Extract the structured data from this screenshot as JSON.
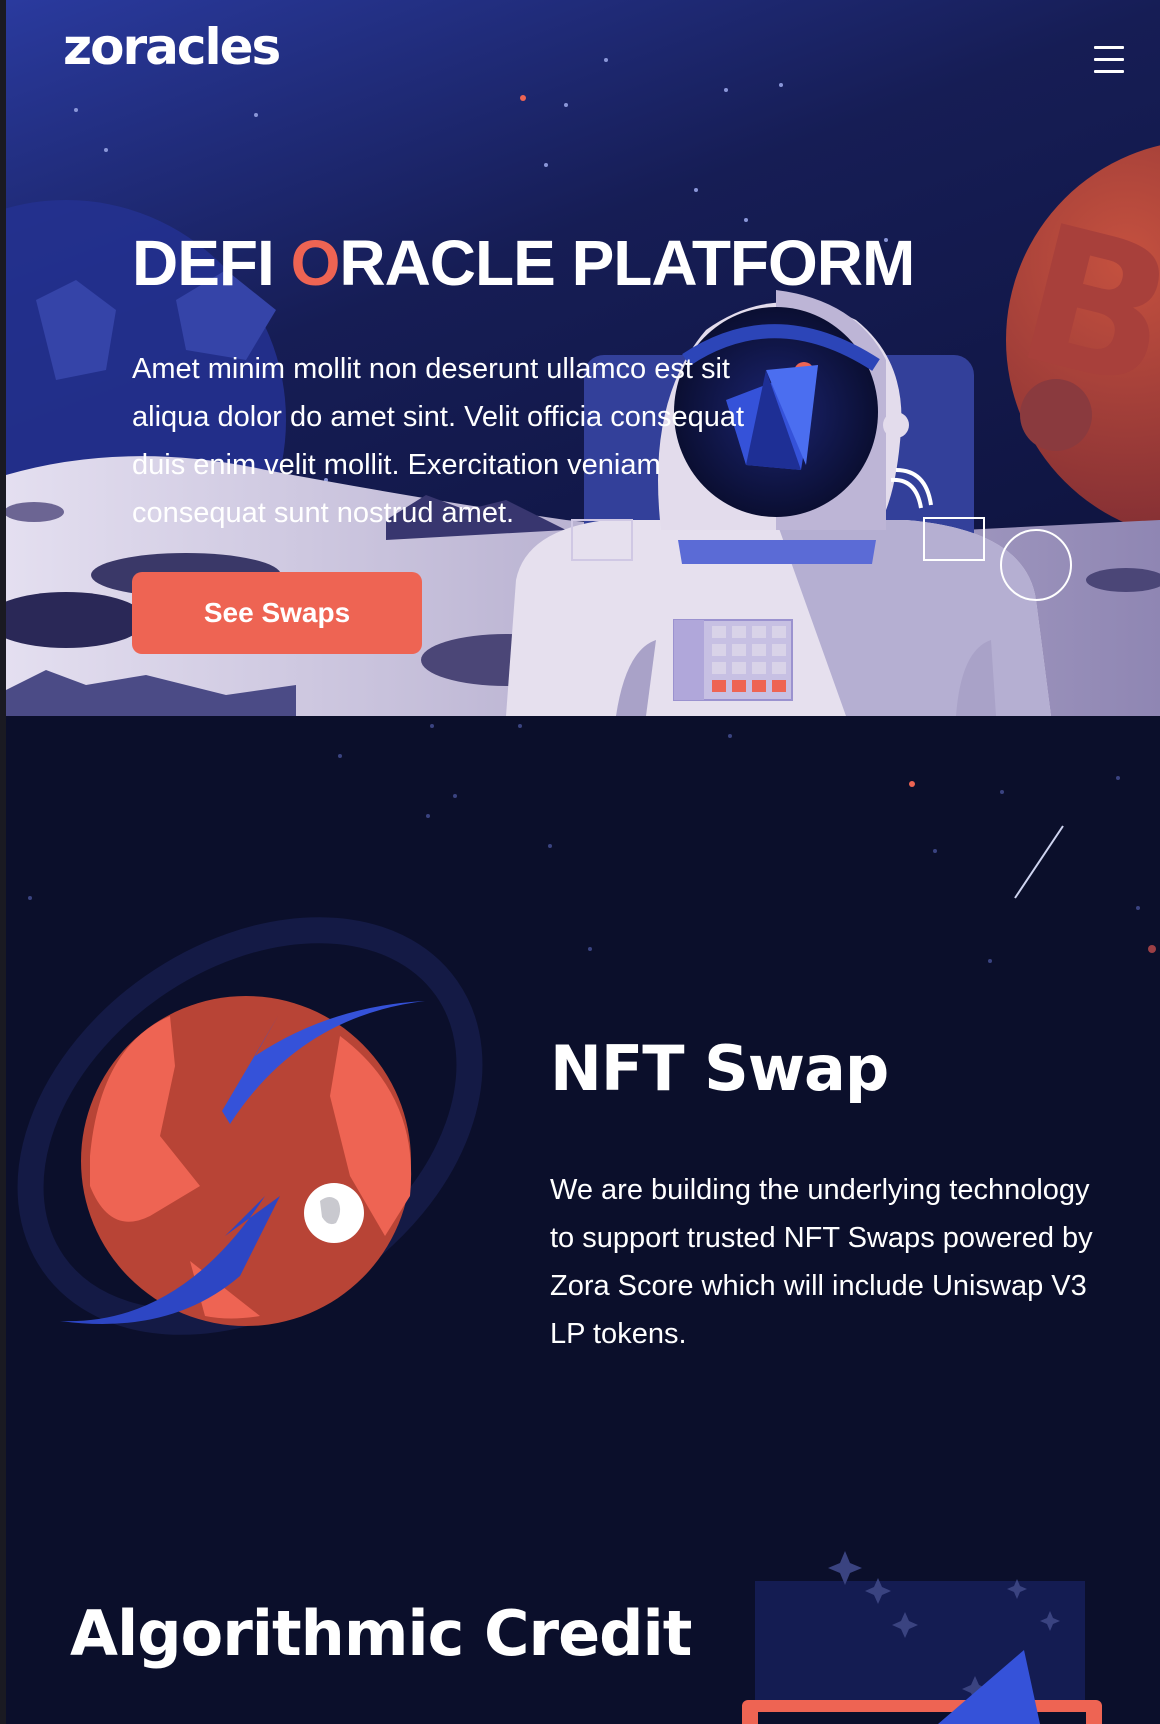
{
  "header": {
    "logo": "zoracles",
    "menu_icon": "hamburger-menu-icon"
  },
  "hero": {
    "title_prefix": "DEFI ",
    "title_accent": "O",
    "title_rest": "RACLE PLATFORM",
    "description": "Amet minim mollit non deserunt ullamco est sit aliqua dolor do amet sint. Velit officia consequat duis enim velit mollit. Exercitation veniam consequat sunt nostrud amet.",
    "cta_label": "See Swaps"
  },
  "features": [
    {
      "title": "NFT Swap",
      "description": "We are building the underlying technology to support trusted NFT Swaps powered by Zora Score which will include Uniswap V3 LP tokens.",
      "illustration_icon": "planet-swap-icon"
    },
    {
      "title": "Algorithmic Credit",
      "illustration_icon": "rocket-chart-icon"
    }
  ],
  "colors": {
    "background": "#0b0f2b",
    "accent": "#ee6453",
    "brand_blue": "#3552d9",
    "moon": "#d7d0e6"
  }
}
